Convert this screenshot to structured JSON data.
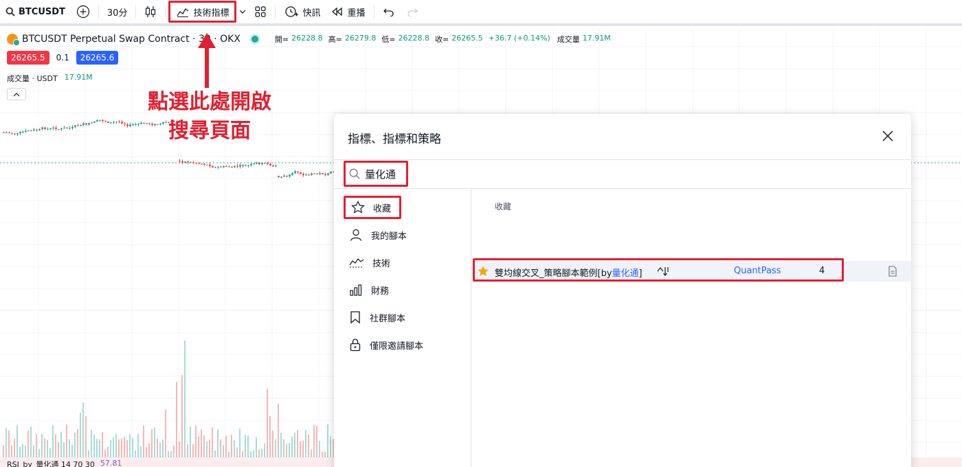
{
  "toolbar": {
    "symbol": "BTCUSDT",
    "interval": "30分",
    "indicators_label": "技術指標",
    "alert_label": "快訊",
    "replay_label": "重播"
  },
  "legend": {
    "title": "BTCUSDT Perpetual Swap Contract · 30 · OKX",
    "open_label": "開=",
    "open": "26228.8",
    "high_label": "高=",
    "high": "26279.8",
    "low_label": "低=",
    "low": "26228.8",
    "close_label": "收=",
    "close": "26265.5",
    "change": "+36.7 (+0.14%)",
    "volume_label": "成交量",
    "volume": "17.91M"
  },
  "prices": {
    "sell": "26265.5",
    "spread": "0.1",
    "buy": "26265.6"
  },
  "volume_pane": {
    "label": "成交量 · USDT",
    "value": "17.91M"
  },
  "rsi_pane": {
    "label": "RSI_by_量化通 14 70 30",
    "value": "57.81"
  },
  "annotation": {
    "line1": "點選此處開啟",
    "line2": "搜尋頁面"
  },
  "dialog": {
    "title": "指標、指標和策略",
    "search_value": "量化通",
    "content_label": "收藏",
    "sidebar": [
      {
        "label": "收藏",
        "icon": "star-icon"
      },
      {
        "label": "我的腳本",
        "icon": "user-icon"
      },
      {
        "label": "技術",
        "icon": "chart-line-icon"
      },
      {
        "label": "財務",
        "icon": "bar-chart-icon"
      },
      {
        "label": "社群腳本",
        "icon": "bookmark-icon"
      },
      {
        "label": "僅限邀請腳本",
        "icon": "lock-icon"
      }
    ],
    "results": [
      {
        "name_prefix": "雙均線交叉_策略腳本範例[by",
        "name_highlight": "量化通",
        "name_suffix": "]",
        "author": "QuantPass",
        "likes": "4"
      }
    ]
  },
  "colors": {
    "accent": "#2962ff",
    "annotation_red": "#e02030",
    "up": "#26a69a",
    "down": "#ef5350"
  }
}
